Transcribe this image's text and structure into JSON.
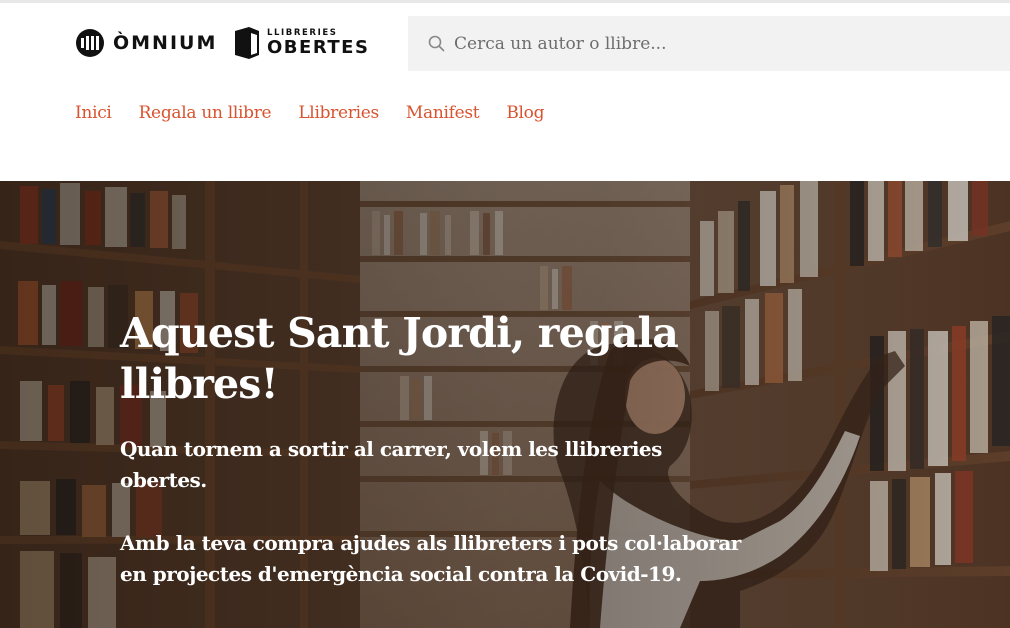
{
  "brand": {
    "omnium": "ÒMNIUM",
    "llibreries_small": "LLIBRERIES",
    "llibreries_big": "OBERTES"
  },
  "search": {
    "placeholder": "Cerca un autor o llibre...",
    "value": ""
  },
  "nav": {
    "items": [
      {
        "label": "Inici"
      },
      {
        "label": "Regala un llibre"
      },
      {
        "label": "Llibreries"
      },
      {
        "label": "Manifest"
      },
      {
        "label": "Blog"
      }
    ]
  },
  "hero": {
    "title": "Aquest Sant Jordi, regala llibres!",
    "paragraph1": "Quan tornem a sortir al carrer, volem les llibreries obertes.",
    "paragraph2": "Amb la teva compra ajudes als llibreters i pots col·laborar en projectes d'emergència social contra la Covid-19."
  },
  "colors": {
    "accent": "#d9532f",
    "search_bg": "#f2f2f2",
    "text_dark": "#111111"
  },
  "icons": [
    "omnium-logo-icon",
    "llibreries-obertes-book-icon",
    "search-icon"
  ]
}
